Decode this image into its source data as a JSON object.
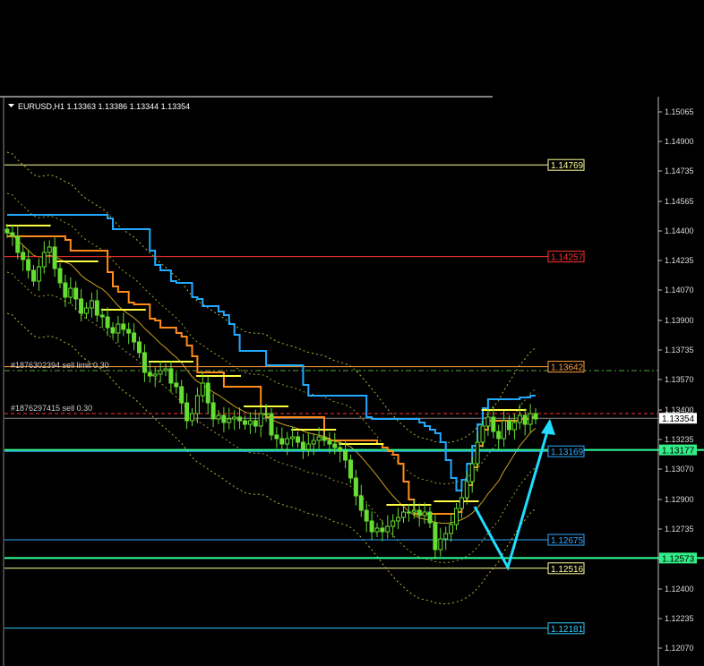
{
  "chart_data": {
    "type": "candlestick",
    "title": "EURUSD,H1  1.13363 1.13386 1.13344 1.13354",
    "ylim": [
      1.1197,
      1.1515
    ],
    "y_ticks": [
      "1.15065",
      "1.14900",
      "1.14735",
      "1.14565",
      "1.14400",
      "1.14235",
      "1.14070",
      "1.13900",
      "1.13735",
      "1.13570",
      "1.13400",
      "1.13235",
      "1.13070",
      "1.12900",
      "1.12735",
      "1.12565",
      "1.12400",
      "1.12235",
      "1.12070"
    ],
    "levels": [
      {
        "label": "1.14769",
        "value": 1.14769,
        "color": "#ffff99"
      },
      {
        "label": "1.14257",
        "value": 1.14257,
        "color": "#ff3333"
      },
      {
        "label": "1.13642",
        "value": 1.13642,
        "color": "#ffa040"
      },
      {
        "label": "1.13169",
        "value": 1.13169,
        "color": "#33aaff"
      },
      {
        "label": "1.12675",
        "value": 1.12675,
        "color": "#33aaff"
      },
      {
        "label": "1.12516",
        "value": 1.12516,
        "color": "#ffff99"
      },
      {
        "label": "1.12181",
        "value": 1.12181,
        "color": "#33ccff"
      }
    ],
    "current_price": {
      "label": "1.13354",
      "value": 1.13354
    },
    "green_levels": [
      {
        "label": "1.13177",
        "value": 1.13177
      },
      {
        "label": "1.12573",
        "value": 1.12573
      }
    ],
    "orders": [
      {
        "text": "#1876302394 sell limit 0.30",
        "value": 1.1362
      },
      {
        "text": "#1876297415 sell 0.30",
        "value": 1.1338
      }
    ],
    "close": [
      1.1439,
      1.1437,
      1.1428,
      1.1424,
      1.1418,
      1.1412,
      1.142,
      1.1428,
      1.1431,
      1.1419,
      1.1411,
      1.1403,
      1.1408,
      1.1402,
      1.1394,
      1.1397,
      1.1401,
      1.1393,
      1.1392,
      1.1386,
      1.1383,
      1.1388,
      1.1385,
      1.1383,
      1.1378,
      1.1372,
      1.1361,
      1.1359,
      1.136,
      1.1362,
      1.1363,
      1.1355,
      1.1353,
      1.1344,
      1.1334,
      1.1338,
      1.1348,
      1.1355,
      1.1344,
      1.1335,
      1.1337,
      1.1333,
      1.1335,
      1.1336,
      1.1334,
      1.1332,
      1.1334,
      1.1331,
      1.1338,
      1.1338,
      1.1326,
      1.1324,
      1.1321,
      1.1324,
      1.1325,
      1.1322,
      1.1318,
      1.1321,
      1.1323,
      1.1325,
      1.1323,
      1.1321,
      1.1319,
      1.1317,
      1.1312,
      1.1302,
      1.1292,
      1.1284,
      1.1278,
      1.1272,
      1.1274,
      1.1272,
      1.1275,
      1.1278,
      1.128,
      1.1283,
      1.1283,
      1.1284,
      1.1281,
      1.1283,
      1.1277,
      1.1262,
      1.1268,
      1.1271,
      1.1276,
      1.1285,
      1.1291,
      1.13,
      1.131,
      1.1322,
      1.1331,
      1.1336,
      1.1328,
      1.1324,
      1.1334,
      1.1329,
      1.1333,
      1.1337,
      1.1332,
      1.1338,
      1.1335
    ]
  }
}
